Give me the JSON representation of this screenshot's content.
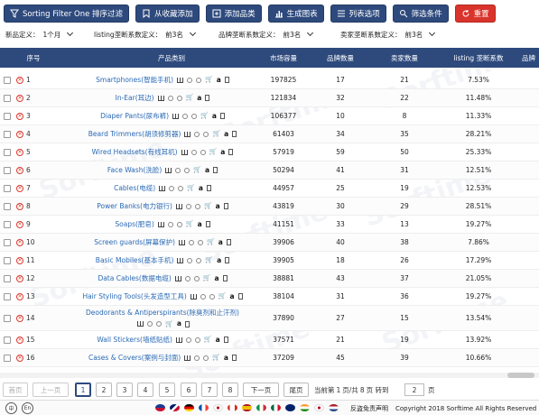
{
  "toolbar": {
    "buttons": [
      {
        "label": "Sorting Filter One 排序过滤",
        "icon": "filter-icon"
      },
      {
        "label": "从收藏添加",
        "icon": "bookmark-icon"
      },
      {
        "label": "添加品类",
        "icon": "add-category-icon"
      },
      {
        "label": "生成图表",
        "icon": "chart-icon"
      },
      {
        "label": "列表选项",
        "icon": "list-icon"
      },
      {
        "label": "筛选条件",
        "icon": "sliders-icon"
      },
      {
        "label": "重置",
        "icon": "reset-icon",
        "color": "#d9342b"
      }
    ]
  },
  "filters": [
    {
      "label": "新品定义：",
      "value": "1个月"
    },
    {
      "label": "listing垄断系数定义：",
      "value": "前3名"
    },
    {
      "label": "品牌垄断系数定义：",
      "value": "前3名"
    },
    {
      "label": "卖家垄断系数定义：",
      "value": "前3名"
    }
  ],
  "table": {
    "headers": [
      "序号",
      "产品类别",
      "市场容量",
      "品牌数量",
      "卖家数量",
      "listing 垄断系数",
      "品牌"
    ],
    "rows": [
      {
        "no": "1",
        "category": "Smartphones(智能手机)",
        "market": "197825",
        "brands": "17",
        "sellers": "21",
        "listing": "7.53%"
      },
      {
        "no": "2",
        "category": "In-Ear(耳边)",
        "market": "121834",
        "brands": "32",
        "sellers": "22",
        "listing": "11.48%"
      },
      {
        "no": "3",
        "category": "Diaper Pants(尿布裤)",
        "market": "106377",
        "brands": "10",
        "sellers": "8",
        "listing": "11.33%"
      },
      {
        "no": "4",
        "category": "Beard Trimmers(胡须修剪器)",
        "market": "61403",
        "brands": "34",
        "sellers": "35",
        "listing": "28.21%"
      },
      {
        "no": "5",
        "category": "Wired Headsets(有线耳机)",
        "market": "57919",
        "brands": "59",
        "sellers": "50",
        "listing": "25.33%"
      },
      {
        "no": "6",
        "category": "Face Wash(洗脸)",
        "market": "50294",
        "brands": "41",
        "sellers": "31",
        "listing": "12.51%"
      },
      {
        "no": "7",
        "category": "Cables(电缆)",
        "market": "44957",
        "brands": "25",
        "sellers": "19",
        "listing": "12.53%"
      },
      {
        "no": "8",
        "category": "Power Banks(电力银行)",
        "market": "43819",
        "brands": "30",
        "sellers": "29",
        "listing": "28.51%"
      },
      {
        "no": "9",
        "category": "Soaps(肥皂)",
        "market": "41151",
        "brands": "33",
        "sellers": "13",
        "listing": "19.27%"
      },
      {
        "no": "10",
        "category": "Screen guards(屏幕保护)",
        "market": "39906",
        "brands": "40",
        "sellers": "38",
        "listing": "7.86%"
      },
      {
        "no": "11",
        "category": "Basic Mobiles(基本手机)",
        "market": "39905",
        "brands": "18",
        "sellers": "26",
        "listing": "17.29%"
      },
      {
        "no": "12",
        "category": "Data Cables(数据电缆)",
        "market": "38881",
        "brands": "43",
        "sellers": "37",
        "listing": "21.05%"
      },
      {
        "no": "13",
        "category": "Hair Styling Tools(头发造型工具)",
        "market": "38104",
        "brands": "31",
        "sellers": "36",
        "listing": "19.27%"
      },
      {
        "no": "14",
        "category": "Deodorants & Antiperspirants(除臭剂和止汗剂)",
        "market": "37890",
        "brands": "27",
        "sellers": "15",
        "listing": "13.54%"
      },
      {
        "no": "15",
        "category": "Wall Stickers(墙纸贴纸)",
        "market": "37571",
        "brands": "21",
        "sellers": "19",
        "listing": "13.92%"
      },
      {
        "no": "16",
        "category": "Cases & Covers(案例与封面)",
        "market": "37209",
        "brands": "45",
        "sellers": "39",
        "listing": "10.66%"
      }
    ]
  },
  "pager": {
    "first": "首页",
    "prev": "上一页",
    "pages": [
      "1",
      "2",
      "3",
      "4",
      "5",
      "6",
      "7",
      "8"
    ],
    "current_page": "1",
    "next": "下一页",
    "last": "尾页",
    "status_prefix": "当前第",
    "status_current": "1",
    "status_mid": "页/共",
    "status_total": "8",
    "status_suffix": "页 转到",
    "goto_value": "2",
    "goto_suffix": "页"
  },
  "footer": {
    "lang_zh": "中",
    "lang_en": "En",
    "disclaimer": "反盗免责声明",
    "copyright": "Copyright 2018 Sorftime All Rights Reserved"
  },
  "watermark": "Sorftime",
  "colors": {
    "accent": "#2e4a7d",
    "danger": "#d9342b",
    "link": "#2a6ab5"
  }
}
